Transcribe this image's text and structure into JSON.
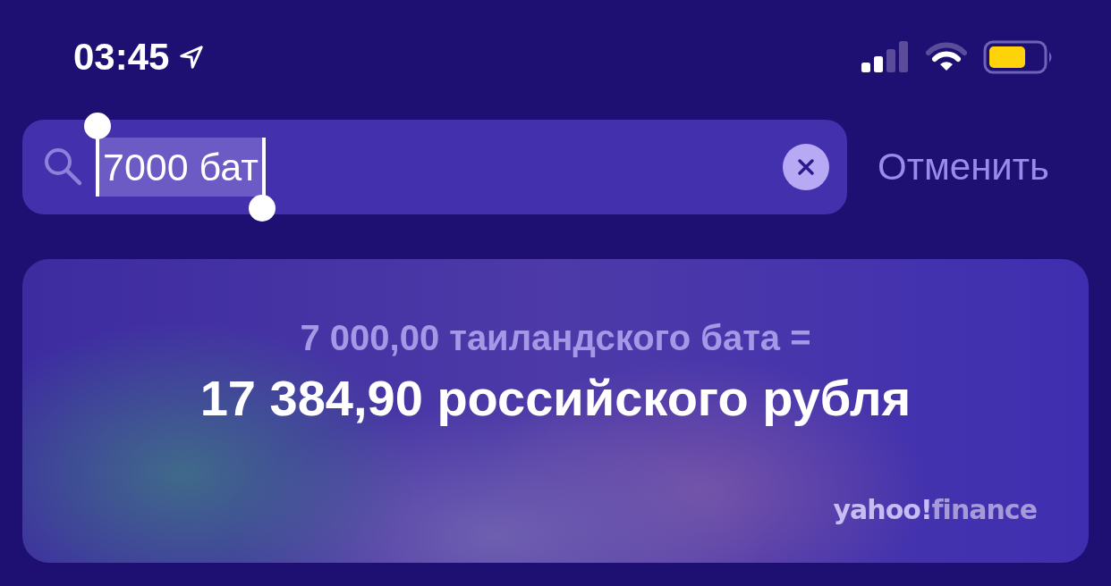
{
  "status_bar": {
    "time": "03:45"
  },
  "search": {
    "value": "7000 бат",
    "selected": true,
    "cancel": "Отменить"
  },
  "result": {
    "query": "7 000,00 таиландского бата =",
    "answer": "17 384,90 российского рубля",
    "source": [
      "yahoo!",
      "finance"
    ]
  }
}
